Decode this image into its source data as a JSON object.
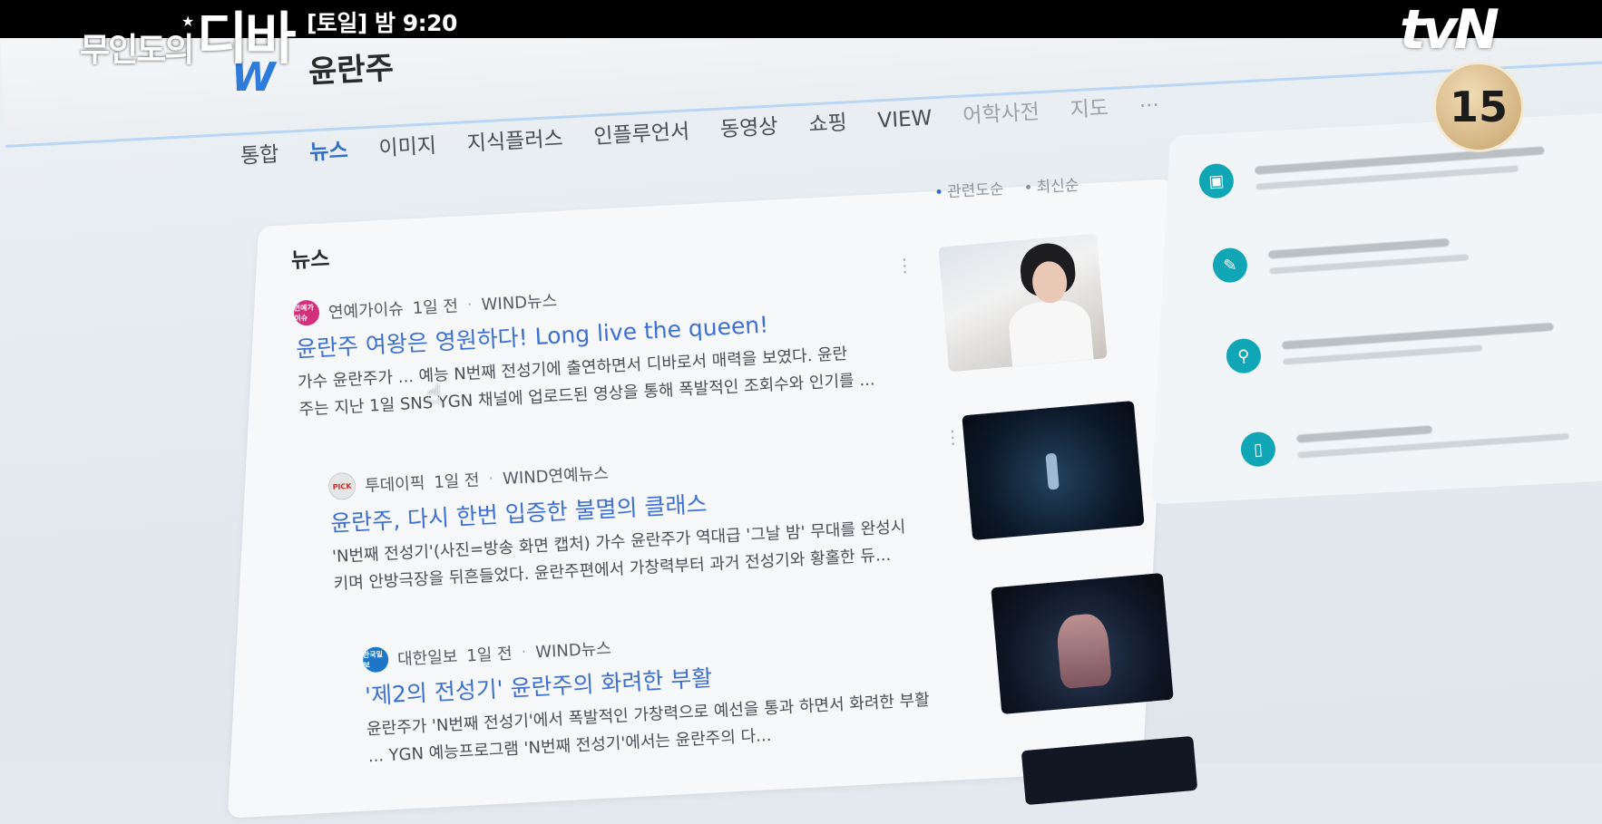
{
  "overlay": {
    "show_logo_small": "무인도의",
    "show_logo_big": "디바",
    "airtime": "[토일] 밤 9:20",
    "channel": "tvN",
    "age_rating": "15"
  },
  "search": {
    "site_logo": "W",
    "query": "윤란주",
    "tabs": [
      {
        "label": "통합"
      },
      {
        "label": "뉴스"
      },
      {
        "label": "이미지"
      },
      {
        "label": "지식플러스"
      },
      {
        "label": "인플루언서"
      },
      {
        "label": "동영상"
      },
      {
        "label": "쇼핑"
      },
      {
        "label": "VIEW"
      },
      {
        "label": "어학사전"
      },
      {
        "label": "지도"
      },
      {
        "label": "···"
      }
    ],
    "sort": {
      "relevance": "관련도순",
      "latest": "최신순"
    }
  },
  "news": {
    "section_title": "뉴스",
    "articles": [
      {
        "press_icon": "연예가이슈",
        "press": "연예가이슈",
        "time": "1일 전",
        "source": "WIND뉴스",
        "headline": "윤란주 여왕은 영원하다! Long live the queen!",
        "summary_line1": "가수 윤란주가 ... 예능 N번째 전성기에 출연하면서 디바로서 매력을 보였다. 윤란",
        "summary_line2": "주는 지난 1일 SNS YGN 채널에 업로드된 영상을 통해 폭발적인 조회수와 인기를 ..."
      },
      {
        "press_icon": "PICK",
        "press": "투데이픽",
        "time": "1일 전",
        "source": "WIND연예뉴스",
        "headline": "윤란주, 다시 한번 입증한 불멸의 클래스",
        "summary_line1": "'N번째 전성기'(사진=방송 화면 캡처) 가수 윤란주가 역대급 '그날 밤' 무대를 완성시",
        "summary_line2": "키며 안방극장을 뒤흔들었다. 윤란주편에서 가창력부터 과거 전성기와 황홀한 듀..."
      },
      {
        "press_icon": "한국일보",
        "press": "대한일보",
        "time": "1일 전",
        "source": "WIND뉴스",
        "headline": "'제2의 전성기' 윤란주의 화려한 부활",
        "summary_line1": "윤란주가 'N번째 전성기'에서 폭발적인 가창력으로 예선을 통과 하면서 화려한 부활",
        "summary_line2": "... YGN 예능프로그램 'N번째 전성기'에서는 윤란주의 다..."
      }
    ]
  },
  "sidebar": {
    "icons": [
      "photo-icon",
      "pencil-icon",
      "search-icon",
      "phone-icon"
    ]
  },
  "colors": {
    "accent_blue": "#2e6fcf",
    "headline_blue": "#3e6fd3",
    "sidebar_teal": "#10a6b5"
  }
}
